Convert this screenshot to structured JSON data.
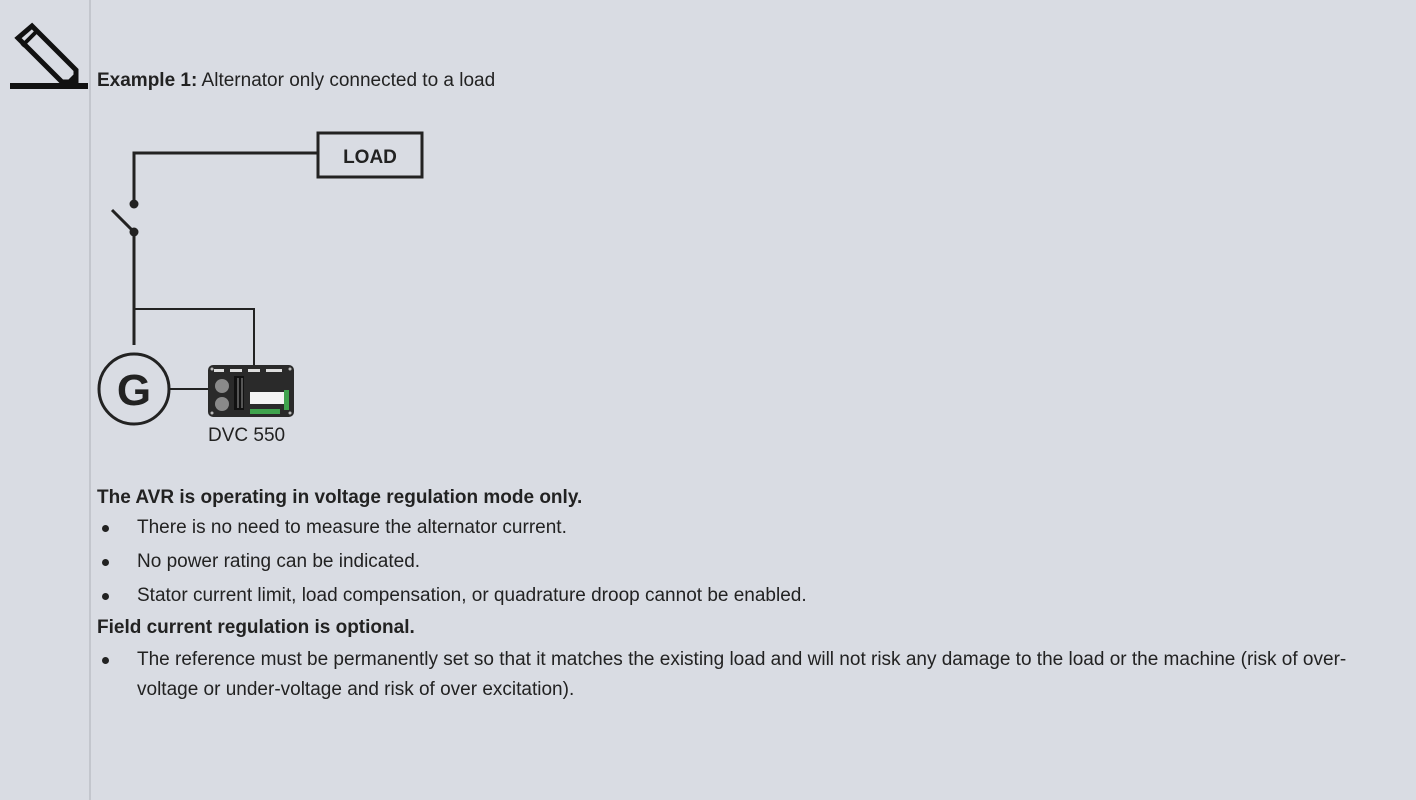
{
  "icons": {
    "note": "pencil-icon"
  },
  "example": {
    "label": "Example 1:",
    "text": " Alternator only connected to a load"
  },
  "diagram": {
    "load_label": "LOAD",
    "generator_label": "G",
    "avr_label": "DVC 550"
  },
  "section1": {
    "heading": "The AVR is operating in voltage regulation mode only.",
    "bullets": [
      "There is no need to measure the alternator current.",
      "No power rating can be indicated.",
      "Stator current limit, load compensation, or quadrature droop cannot be enabled."
    ]
  },
  "section2": {
    "heading": "Field current regulation is optional.",
    "bullets": [
      "The reference must be permanently set so that it matches the existing load and will not risk any damage to the load or the machine (risk of over-voltage or under-voltage and risk of over excitation)."
    ]
  }
}
